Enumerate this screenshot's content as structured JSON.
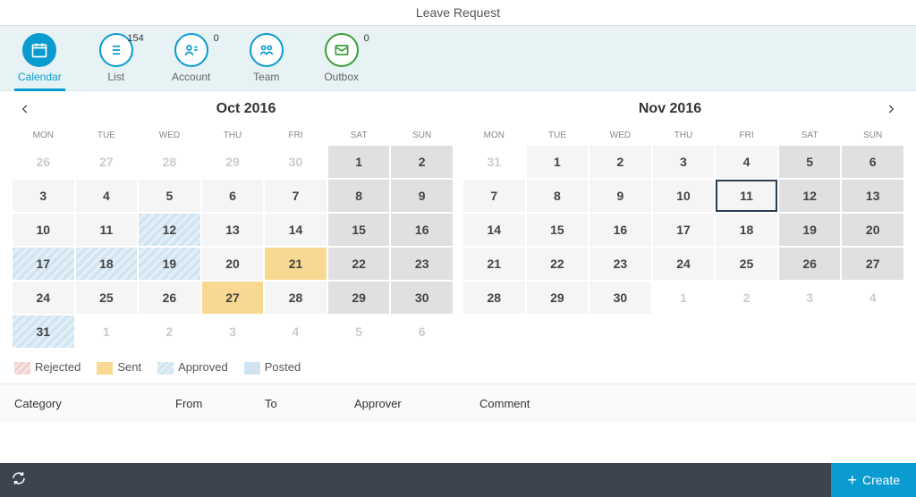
{
  "title": "Leave Request",
  "tabs": {
    "calendar": "Calendar",
    "list": "List",
    "list_badge": "154",
    "account": "Account",
    "account_badge": "0",
    "team": "Team",
    "outbox": "Outbox",
    "outbox_badge": "0"
  },
  "months": {
    "left": "Oct 2016",
    "right": "Nov 2016"
  },
  "dow": [
    "MON",
    "TUE",
    "WED",
    "THU",
    "FRI",
    "SAT",
    "SUN"
  ],
  "oct": [
    {
      "d": "26",
      "cls": "muted"
    },
    {
      "d": "27",
      "cls": "muted"
    },
    {
      "d": "28",
      "cls": "muted"
    },
    {
      "d": "29",
      "cls": "muted"
    },
    {
      "d": "30",
      "cls": "muted"
    },
    {
      "d": "1",
      "cls": "dark"
    },
    {
      "d": "2",
      "cls": "dark"
    },
    {
      "d": "3",
      "cls": "glow"
    },
    {
      "d": "4",
      "cls": "glow"
    },
    {
      "d": "5",
      "cls": "glow"
    },
    {
      "d": "6",
      "cls": "glow"
    },
    {
      "d": "7",
      "cls": "glow"
    },
    {
      "d": "8",
      "cls": "dark"
    },
    {
      "d": "9",
      "cls": "dark"
    },
    {
      "d": "10",
      "cls": "glow"
    },
    {
      "d": "11",
      "cls": "glow"
    },
    {
      "d": "12",
      "cls": "approved"
    },
    {
      "d": "13",
      "cls": "glow"
    },
    {
      "d": "14",
      "cls": "glow"
    },
    {
      "d": "15",
      "cls": "dark"
    },
    {
      "d": "16",
      "cls": "dark"
    },
    {
      "d": "17",
      "cls": "approved"
    },
    {
      "d": "18",
      "cls": "approved"
    },
    {
      "d": "19",
      "cls": "approved"
    },
    {
      "d": "20",
      "cls": "glow"
    },
    {
      "d": "21",
      "cls": "sent"
    },
    {
      "d": "22",
      "cls": "dark"
    },
    {
      "d": "23",
      "cls": "dark"
    },
    {
      "d": "24",
      "cls": "glow"
    },
    {
      "d": "25",
      "cls": "glow"
    },
    {
      "d": "26",
      "cls": "glow"
    },
    {
      "d": "27",
      "cls": "sent"
    },
    {
      "d": "28",
      "cls": "glow"
    },
    {
      "d": "29",
      "cls": "dark"
    },
    {
      "d": "30",
      "cls": "dark"
    },
    {
      "d": "31",
      "cls": "approved"
    },
    {
      "d": "1",
      "cls": "muted"
    },
    {
      "d": "2",
      "cls": "muted"
    },
    {
      "d": "3",
      "cls": "muted"
    },
    {
      "d": "4",
      "cls": "muted"
    },
    {
      "d": "5",
      "cls": "muted"
    },
    {
      "d": "6",
      "cls": "muted"
    }
  ],
  "nov": [
    {
      "d": "31",
      "cls": "muted"
    },
    {
      "d": "1",
      "cls": "glow"
    },
    {
      "d": "2",
      "cls": "glow"
    },
    {
      "d": "3",
      "cls": "glow"
    },
    {
      "d": "4",
      "cls": "glow"
    },
    {
      "d": "5",
      "cls": "dark"
    },
    {
      "d": "6",
      "cls": "dark"
    },
    {
      "d": "7",
      "cls": "glow"
    },
    {
      "d": "8",
      "cls": "glow"
    },
    {
      "d": "9",
      "cls": "glow"
    },
    {
      "d": "10",
      "cls": "glow"
    },
    {
      "d": "11",
      "cls": "glow today"
    },
    {
      "d": "12",
      "cls": "dark"
    },
    {
      "d": "13",
      "cls": "dark"
    },
    {
      "d": "14",
      "cls": "glow"
    },
    {
      "d": "15",
      "cls": "glow"
    },
    {
      "d": "16",
      "cls": "glow"
    },
    {
      "d": "17",
      "cls": "glow"
    },
    {
      "d": "18",
      "cls": "glow"
    },
    {
      "d": "19",
      "cls": "dark"
    },
    {
      "d": "20",
      "cls": "dark"
    },
    {
      "d": "21",
      "cls": "glow"
    },
    {
      "d": "22",
      "cls": "glow"
    },
    {
      "d": "23",
      "cls": "glow"
    },
    {
      "d": "24",
      "cls": "glow"
    },
    {
      "d": "25",
      "cls": "glow"
    },
    {
      "d": "26",
      "cls": "dark"
    },
    {
      "d": "27",
      "cls": "dark"
    },
    {
      "d": "28",
      "cls": "glow"
    },
    {
      "d": "29",
      "cls": "glow"
    },
    {
      "d": "30",
      "cls": "glow"
    },
    {
      "d": "1",
      "cls": "muted"
    },
    {
      "d": "2",
      "cls": "muted"
    },
    {
      "d": "3",
      "cls": "muted"
    },
    {
      "d": "4",
      "cls": "muted"
    }
  ],
  "legend": {
    "rejected": "Rejected",
    "sent": "Sent",
    "approved": "Approved",
    "posted": "Posted"
  },
  "table": {
    "category": "Category",
    "from": "From",
    "to": "To",
    "approver": "Approver",
    "comment": "Comment"
  },
  "footer": {
    "create": "Create"
  }
}
